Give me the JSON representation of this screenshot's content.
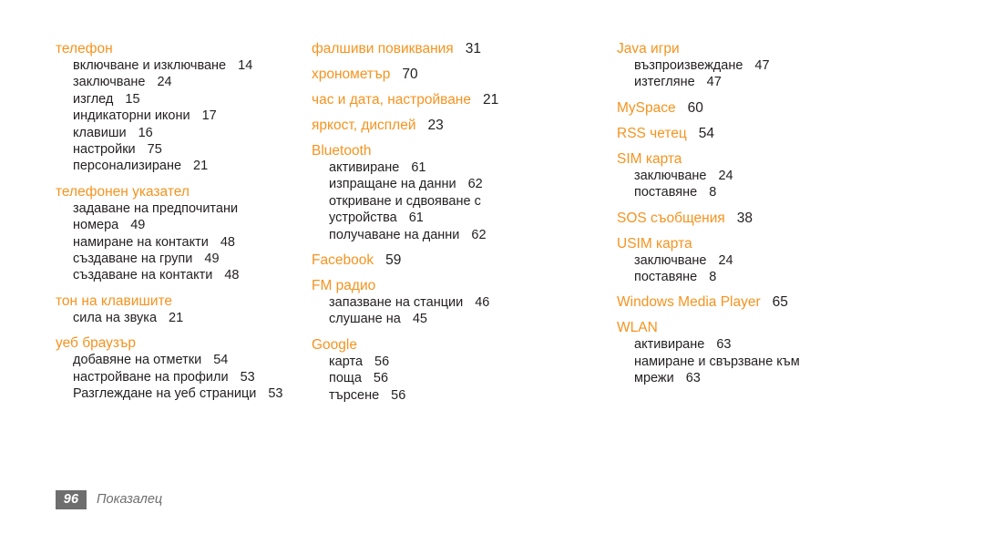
{
  "document": {
    "type": "index",
    "language": "bg",
    "footer": {
      "page_number": "96",
      "section_label": "Показалец"
    },
    "colors": {
      "heading_orange": "#f5931f",
      "body_text": "#231f20",
      "footer_gray": "#6e6e6e",
      "background": "#ffffff"
    }
  },
  "columns": [
    {
      "id": "column-1",
      "groups": [
        {
          "heading": "телефон",
          "heading_page": "",
          "entries": [
            {
              "label": "включване и изключване",
              "page": "14"
            },
            {
              "label": "заключване",
              "page": "24"
            },
            {
              "label": "изглед",
              "page": "15"
            },
            {
              "label": "индикаторни икони",
              "page": "17"
            },
            {
              "label": "клавиши",
              "page": "16"
            },
            {
              "label": "настройки",
              "page": "75"
            },
            {
              "label": "персонализиране",
              "page": "21"
            }
          ]
        },
        {
          "heading": "телефонен указател",
          "heading_page": "",
          "entries": [
            {
              "label": "задаване на предпочитани",
              "page": ""
            },
            {
              "label": "номера",
              "page": "49",
              "continuation": true
            },
            {
              "label": "намиране на контакти",
              "page": "48"
            },
            {
              "label": "създаване на групи",
              "page": "49"
            },
            {
              "label": "създаване на контакти",
              "page": "48"
            }
          ]
        },
        {
          "heading": "тон на клавишите",
          "heading_page": "",
          "entries": [
            {
              "label": "сила на звука",
              "page": "21"
            }
          ]
        },
        {
          "heading": "уеб браузър",
          "heading_page": "",
          "entries": [
            {
              "label": "добавяне на отметки",
              "page": "54"
            },
            {
              "label": "настройване на профили",
              "page": "53"
            },
            {
              "label": "Разглеждане на уеб страници",
              "page": "53"
            }
          ]
        }
      ]
    },
    {
      "id": "column-2",
      "groups": [
        {
          "heading": "фалшиви повиквания",
          "heading_page": "31",
          "entries": []
        },
        {
          "heading": "хронометър",
          "heading_page": "70",
          "entries": []
        },
        {
          "heading": "час и дата, настройване",
          "heading_page": "21",
          "entries": []
        },
        {
          "heading": "яркост, дисплей",
          "heading_page": "23",
          "entries": []
        },
        {
          "heading": "Bluetooth",
          "heading_page": "",
          "entries": [
            {
              "label": "активиране",
              "page": "61"
            },
            {
              "label": "изпращане на данни",
              "page": "62"
            },
            {
              "label": "откриване и сдвояване с",
              "page": ""
            },
            {
              "label": "устройства",
              "page": "61",
              "continuation": true
            },
            {
              "label": "получаване на данни",
              "page": "62"
            }
          ]
        },
        {
          "heading": "Facebook",
          "heading_page": "59",
          "entries": []
        },
        {
          "heading": "FM радио",
          "heading_page": "",
          "entries": [
            {
              "label": "запазване на станции",
              "page": "46"
            },
            {
              "label": "слушане на",
              "page": "45"
            }
          ]
        },
        {
          "heading": "Google",
          "heading_page": "",
          "entries": [
            {
              "label": "карта",
              "page": "56"
            },
            {
              "label": "поща",
              "page": "56"
            },
            {
              "label": "търсене",
              "page": "56"
            }
          ]
        }
      ]
    },
    {
      "id": "column-3",
      "groups": [
        {
          "heading": "Java игри",
          "heading_page": "",
          "entries": [
            {
              "label": "възпроизвеждане",
              "page": "47"
            },
            {
              "label": "изтегляне",
              "page": "47"
            }
          ]
        },
        {
          "heading": "MySpace",
          "heading_page": "60",
          "entries": []
        },
        {
          "heading": "RSS четец",
          "heading_page": "54",
          "entries": []
        },
        {
          "heading": "SIM карта",
          "heading_page": "",
          "entries": [
            {
              "label": "заключване",
              "page": "24"
            },
            {
              "label": "поставяне",
              "page": "8"
            }
          ]
        },
        {
          "heading": "SOS съобщения",
          "heading_page": "38",
          "entries": []
        },
        {
          "heading": "USIM карта",
          "heading_page": "",
          "entries": [
            {
              "label": "заключване",
              "page": "24"
            },
            {
              "label": "поставяне",
              "page": "8"
            }
          ]
        },
        {
          "heading": "Windows Media Player",
          "heading_page": "65",
          "entries": []
        },
        {
          "heading": "WLAN",
          "heading_page": "",
          "entries": [
            {
              "label": "активиране",
              "page": "63"
            },
            {
              "label": "намиране и свързване към",
              "page": ""
            },
            {
              "label": "мрежи",
              "page": "63",
              "continuation": true
            }
          ]
        }
      ]
    }
  ]
}
